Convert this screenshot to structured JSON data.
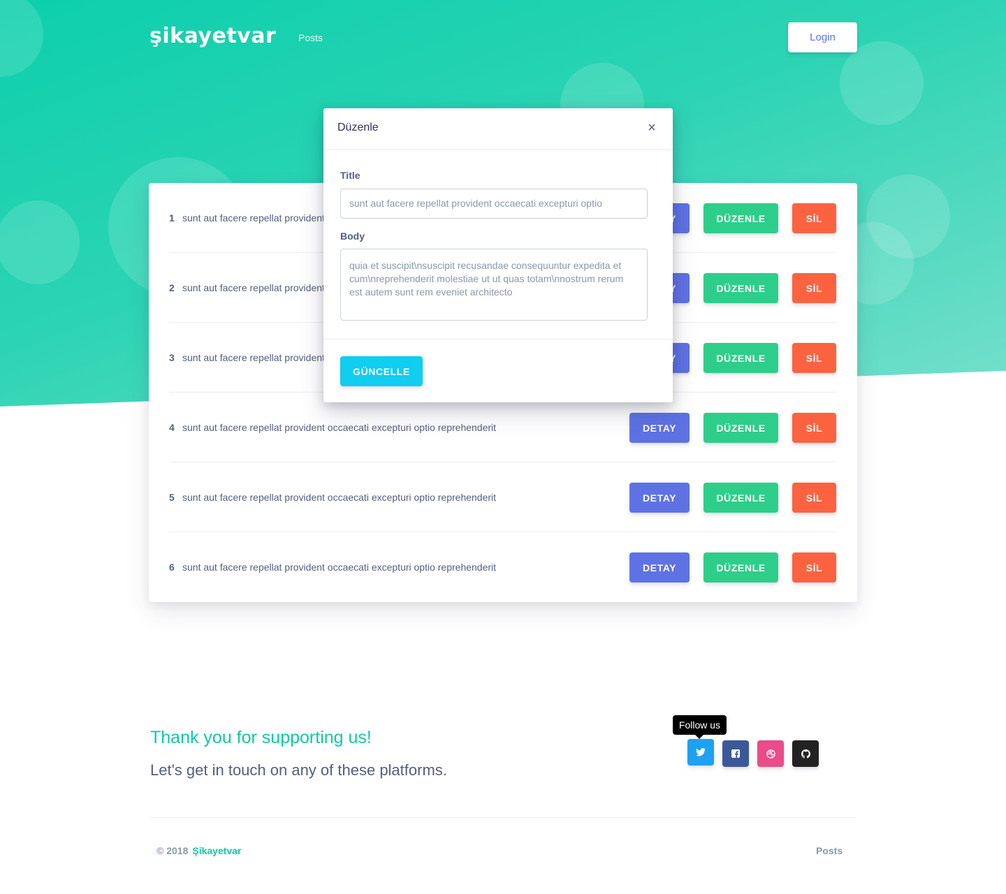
{
  "colors": {
    "hero_start": "#0ccfac",
    "primary": "#5e72e4",
    "success": "#2dce89",
    "warning": "#fb6340",
    "info": "#11cdef",
    "brand_text": "#11c9a4"
  },
  "header": {
    "logo": "şikayetvar",
    "nav_posts": "Posts",
    "login_label": "Login"
  },
  "posts": [
    {
      "id": "1",
      "title": "sunt aut facere repellat provident occaecati excepturi optio reprehenderit"
    },
    {
      "id": "2",
      "title": "sunt aut facere repellat provident occaecati excepturi optio reprehenderit"
    },
    {
      "id": "3",
      "title": "sunt aut facere repellat provident occaecati excepturi optio reprehenderit"
    },
    {
      "id": "4",
      "title": "sunt aut facere repellat provident occaecati excepturi optio reprehenderit"
    },
    {
      "id": "5",
      "title": "sunt aut facere repellat provident occaecati excepturi optio reprehenderit"
    },
    {
      "id": "6",
      "title": "sunt aut facere repellat provident occaecati excepturi optio reprehenderit"
    }
  ],
  "row_buttons": {
    "detail": "DETAY",
    "edit": "DÜZENLE",
    "delete": "SİL"
  },
  "modal": {
    "title": "Düzenle",
    "close": "×",
    "title_label": "Title",
    "title_value": "sunt aut facere repellat provident occaecati excepturi optio",
    "body_label": "Body",
    "body_value": "quia et suscipit\\nsuscipit recusandae consequuntur expedita et cum\\nreprehenderit molestiae ut ut quas totam\\nnostrum rerum est autem sunt rem eveniet architecto",
    "update_label": "GÜNCELLE"
  },
  "footer": {
    "thanks": "Thank you for supporting us!",
    "touch": "Let's get in touch on any of these platforms.",
    "tooltip": "Follow us",
    "social_icons": [
      "twitter-icon",
      "facebook-icon",
      "dribbble-icon",
      "github-icon"
    ],
    "copyright": "© 2018",
    "brand": "Şikayetvar",
    "posts_link": "Posts"
  }
}
